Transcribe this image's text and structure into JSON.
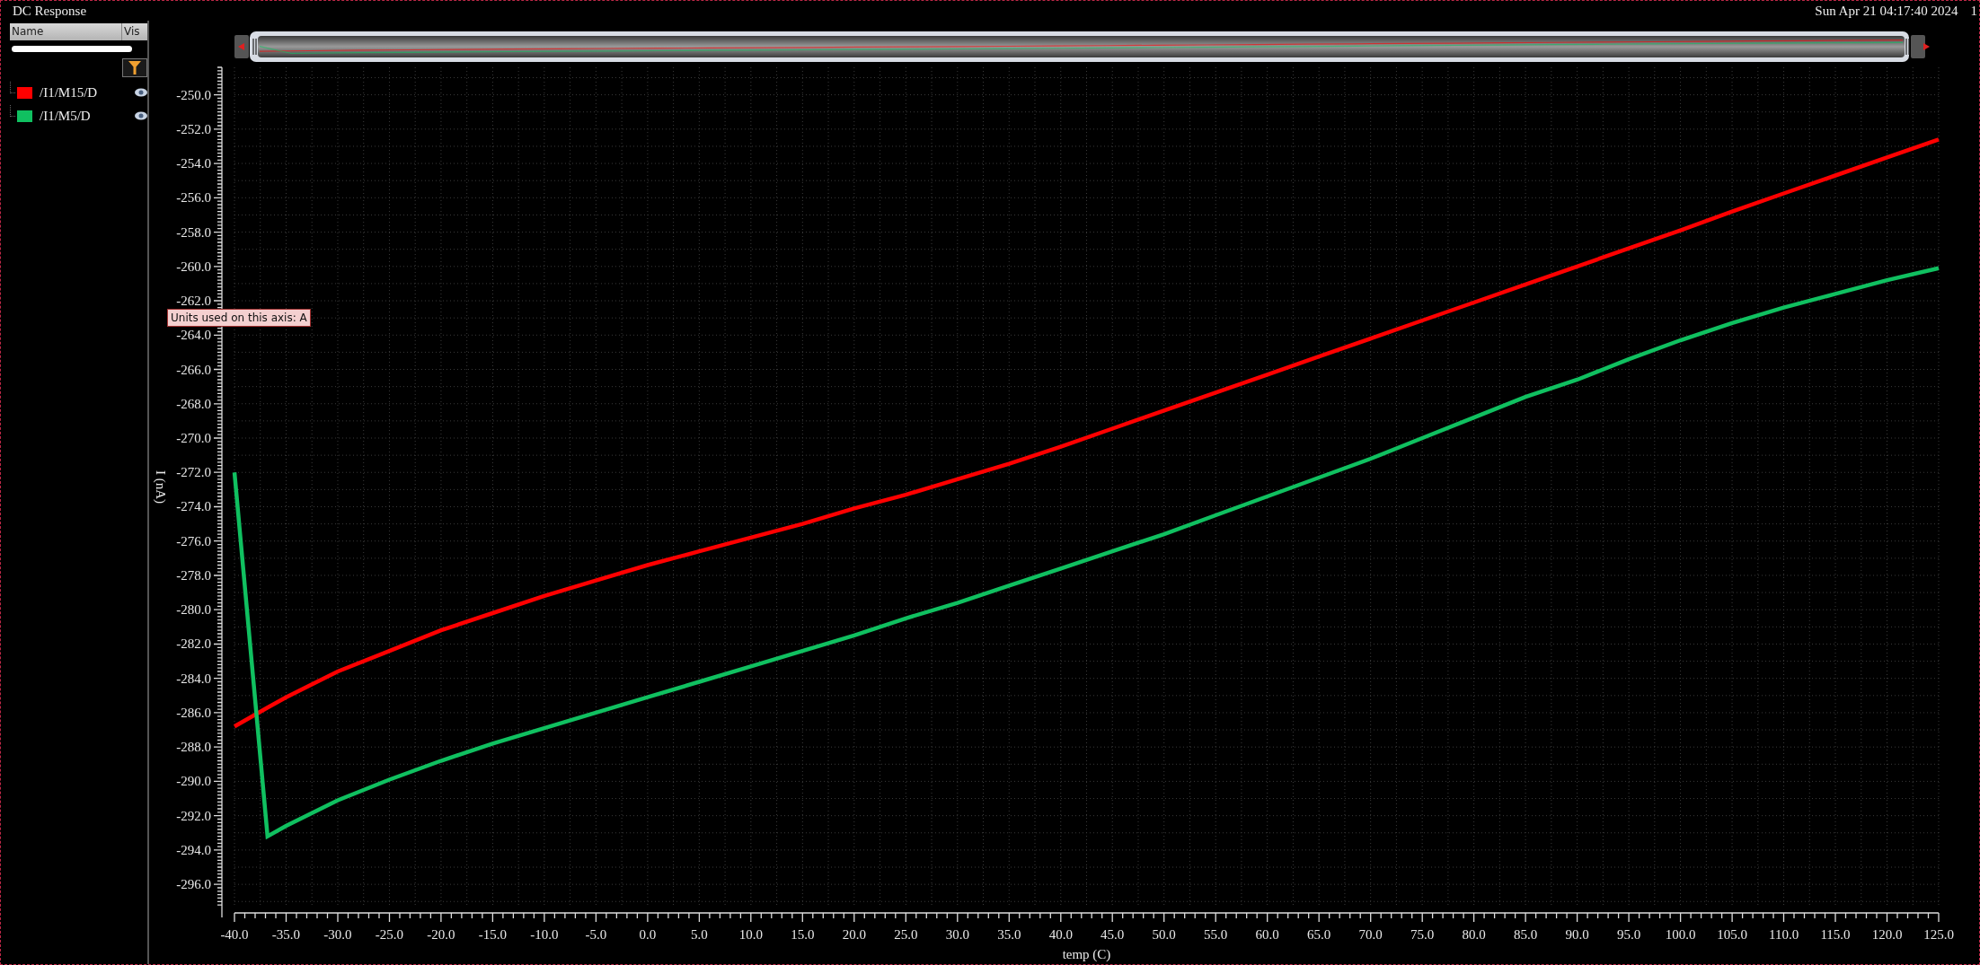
{
  "window": {
    "title": "DC Response",
    "timestamp": "Sun Apr 21 04:17:40 2024",
    "corner_text": "1"
  },
  "trace_list": {
    "columns": [
      "Name",
      "Vis"
    ],
    "traces": [
      {
        "name": "/I1/M15/D",
        "color": "#ff0000",
        "visible": true
      },
      {
        "name": "/I1/M5/D",
        "color": "#10c060",
        "visible": true
      }
    ]
  },
  "tooltip": "Units used on this axis: A",
  "chart_data": {
    "type": "line",
    "xlabel": "temp (C)",
    "ylabel": "I (nA)",
    "x": [
      -40,
      -36.8,
      -35,
      -30,
      -25,
      -20,
      -15,
      -10,
      -5,
      0,
      5,
      10,
      15,
      20,
      25,
      30,
      35,
      40,
      45,
      50,
      55,
      60,
      65,
      70,
      75,
      80,
      85,
      90,
      95,
      100,
      105,
      110,
      115,
      120,
      125
    ],
    "series": [
      {
        "color": "#ff0000",
        "values": [
          -286.8,
          -285.7,
          -285.1,
          -283.6,
          -282.4,
          -281.2,
          -280.2,
          -279.2,
          -278.3,
          -277.4,
          -276.6,
          -275.8,
          -275.0,
          -274.1,
          -273.3,
          -272.4,
          -271.5,
          -270.5,
          -269.45,
          -268.4,
          -267.35,
          -266.3,
          -265.25,
          -264.2,
          -263.15,
          -262.1,
          -261.05,
          -260.0,
          -258.95,
          -257.9,
          -256.8,
          -255.75,
          -254.7,
          -253.65,
          -252.6
        ]
      },
      {
        "color": "#10c060",
        "values": [
          -272.0,
          -293.2,
          -292.6,
          -291.1,
          -289.9,
          -288.8,
          -287.8,
          -286.9,
          -286.0,
          -285.1,
          -284.2,
          -283.3,
          -282.4,
          -281.5,
          -280.5,
          -279.6,
          -278.6,
          -277.6,
          -276.6,
          -275.6,
          -274.5,
          -273.4,
          -272.3,
          -271.2,
          -270.0,
          -268.8,
          -267.6,
          -266.6,
          -265.4,
          -264.3,
          -263.3,
          -262.4,
          -261.6,
          -260.8,
          -260.1
        ]
      }
    ],
    "xlim": [
      -40,
      125
    ],
    "ylim": [
      -297.3,
      -248.4
    ],
    "grid": true,
    "xticks": [
      {
        "value": -40,
        "label": "-40.0"
      },
      {
        "value": -35,
        "label": "-35.0"
      },
      {
        "value": -30,
        "label": "-30.0"
      },
      {
        "value": -25,
        "label": "-25.0"
      },
      {
        "value": -20,
        "label": "-20.0"
      },
      {
        "value": -15,
        "label": "-15.0"
      },
      {
        "value": -10,
        "label": "-10.0"
      },
      {
        "value": -5,
        "label": "-5.0"
      },
      {
        "value": 0,
        "label": "0.0"
      },
      {
        "value": 5,
        "label": "5.0"
      },
      {
        "value": 10,
        "label": "10.0"
      },
      {
        "value": 15,
        "label": "15.0"
      },
      {
        "value": 20,
        "label": "20.0"
      },
      {
        "value": 25,
        "label": "25.0"
      },
      {
        "value": 30,
        "label": "30.0"
      },
      {
        "value": 35,
        "label": "35.0"
      },
      {
        "value": 40,
        "label": "40.0"
      },
      {
        "value": 45,
        "label": "45.0"
      },
      {
        "value": 50,
        "label": "50.0"
      },
      {
        "value": 55,
        "label": "55.0"
      },
      {
        "value": 60,
        "label": "60.0"
      },
      {
        "value": 65,
        "label": "65.0"
      },
      {
        "value": 70,
        "label": "70.0"
      },
      {
        "value": 75,
        "label": "75.0"
      },
      {
        "value": 80,
        "label": "80.0"
      },
      {
        "value": 85,
        "label": "85.0"
      },
      {
        "value": 90,
        "label": "90.0"
      },
      {
        "value": 95,
        "label": "95.0"
      },
      {
        "value": 100,
        "label": "100.0"
      },
      {
        "value": 105,
        "label": "105.0"
      },
      {
        "value": 110,
        "label": "110.0"
      },
      {
        "value": 115,
        "label": "115.0"
      },
      {
        "value": 120,
        "label": "120.0"
      },
      {
        "value": 125,
        "label": "125.0"
      }
    ],
    "yticks": [
      {
        "value": -296,
        "label": "-296.0"
      },
      {
        "value": -294,
        "label": "-294.0"
      },
      {
        "value": -292,
        "label": "-292.0"
      },
      {
        "value": -290,
        "label": "-290.0"
      },
      {
        "value": -288,
        "label": "-288.0"
      },
      {
        "value": -286,
        "label": "-286.0"
      },
      {
        "value": -284,
        "label": "-284.0"
      },
      {
        "value": -282,
        "label": "-282.0"
      },
      {
        "value": -280,
        "label": "-280.0"
      },
      {
        "value": -278,
        "label": "-278.0"
      },
      {
        "value": -276,
        "label": "-276.0"
      },
      {
        "value": -274,
        "label": "-274.0"
      },
      {
        "value": -272,
        "label": "-272.0"
      },
      {
        "value": -270,
        "label": "-270.0"
      },
      {
        "value": -268,
        "label": "-268.0"
      },
      {
        "value": -266,
        "label": "-266.0"
      },
      {
        "value": -264,
        "label": "-264.0"
      },
      {
        "value": -262,
        "label": "-262.0"
      },
      {
        "value": -260,
        "label": "-260.0"
      },
      {
        "value": -258,
        "label": "-258.0"
      },
      {
        "value": -256,
        "label": "-256.0"
      },
      {
        "value": -254,
        "label": "-254.0"
      },
      {
        "value": -252,
        "label": "-252.0"
      },
      {
        "value": -250,
        "label": "-250.0"
      }
    ]
  }
}
